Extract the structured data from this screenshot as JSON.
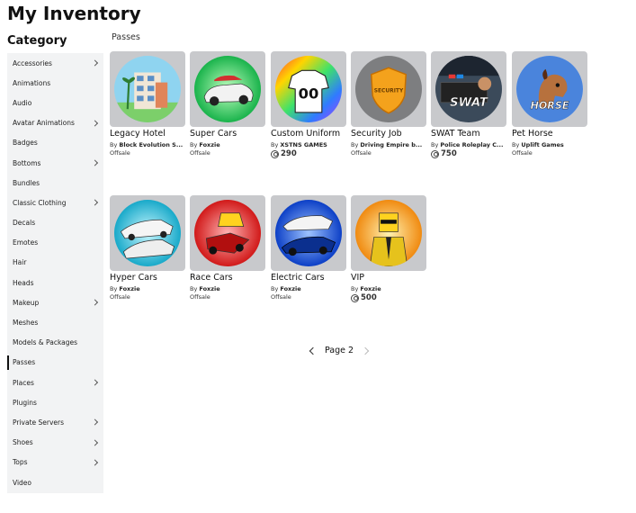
{
  "header": {
    "title": "My Inventory"
  },
  "sidebar": {
    "heading": "Category",
    "items": [
      {
        "label": "Accessories",
        "chevron": true
      },
      {
        "label": "Animations",
        "chevron": false
      },
      {
        "label": "Audio",
        "chevron": false
      },
      {
        "label": "Avatar Animations",
        "chevron": true
      },
      {
        "label": "Badges",
        "chevron": false
      },
      {
        "label": "Bottoms",
        "chevron": true
      },
      {
        "label": "Bundles",
        "chevron": false
      },
      {
        "label": "Classic Clothing",
        "chevron": true
      },
      {
        "label": "Decals",
        "chevron": false
      },
      {
        "label": "Emotes",
        "chevron": false
      },
      {
        "label": "Hair",
        "chevron": false
      },
      {
        "label": "Heads",
        "chevron": false
      },
      {
        "label": "Makeup",
        "chevron": true
      },
      {
        "label": "Meshes",
        "chevron": false
      },
      {
        "label": "Models & Packages",
        "chevron": false
      },
      {
        "label": "Passes",
        "chevron": false,
        "active": true
      },
      {
        "label": "Places",
        "chevron": true
      },
      {
        "label": "Plugins",
        "chevron": false
      },
      {
        "label": "Private Servers",
        "chevron": true
      },
      {
        "label": "Shoes",
        "chevron": true
      },
      {
        "label": "Tops",
        "chevron": true
      },
      {
        "label": "Video",
        "chevron": false
      }
    ]
  },
  "main": {
    "section": "Passes",
    "items": [
      {
        "title": "Legacy Hotel",
        "by_prefix": "By",
        "creator": "Block Evolution S...",
        "status": "Offsale",
        "icon": "hotel-icon"
      },
      {
        "title": "Super Cars",
        "by_prefix": "By",
        "creator": "Foxzie",
        "status": "Offsale",
        "icon": "super-car-icon"
      },
      {
        "title": "Custom Uniform",
        "by_prefix": "By",
        "creator": "XSTNS GAMES",
        "price": "290",
        "icon": "jersey-icon"
      },
      {
        "title": "Security Job",
        "by_prefix": "By",
        "creator": "Driving Empire b...",
        "status": "Offsale",
        "icon": "security-badge-icon"
      },
      {
        "title": "SWAT Team",
        "by_prefix": "By",
        "creator": "Police Roleplay C...",
        "price": "750",
        "icon": "swat-icon",
        "overlay": "SWAT"
      },
      {
        "title": "Pet Horse",
        "by_prefix": "By",
        "creator": "Uplift Games",
        "status": "Offsale",
        "icon": "horse-icon",
        "overlay": "HORSE"
      },
      {
        "title": "Hyper Cars",
        "by_prefix": "By",
        "creator": "Foxzie",
        "status": "Offsale",
        "icon": "hyper-car-icon"
      },
      {
        "title": "Race Cars",
        "by_prefix": "By",
        "creator": "Foxzie",
        "status": "Offsale",
        "icon": "race-car-icon"
      },
      {
        "title": "Electric Cars",
        "by_prefix": "By",
        "creator": "Foxzie",
        "status": "Offsale",
        "icon": "electric-car-icon"
      },
      {
        "title": "VIP",
        "by_prefix": "By",
        "creator": "Foxzie",
        "price": "500",
        "icon": "vip-icon"
      }
    ]
  },
  "pager": {
    "label": "Page 2"
  },
  "colors": {
    "sidebar_bg": "#f2f3f4",
    "thumb_bg": "#c8c9cc",
    "text": "#111111"
  }
}
